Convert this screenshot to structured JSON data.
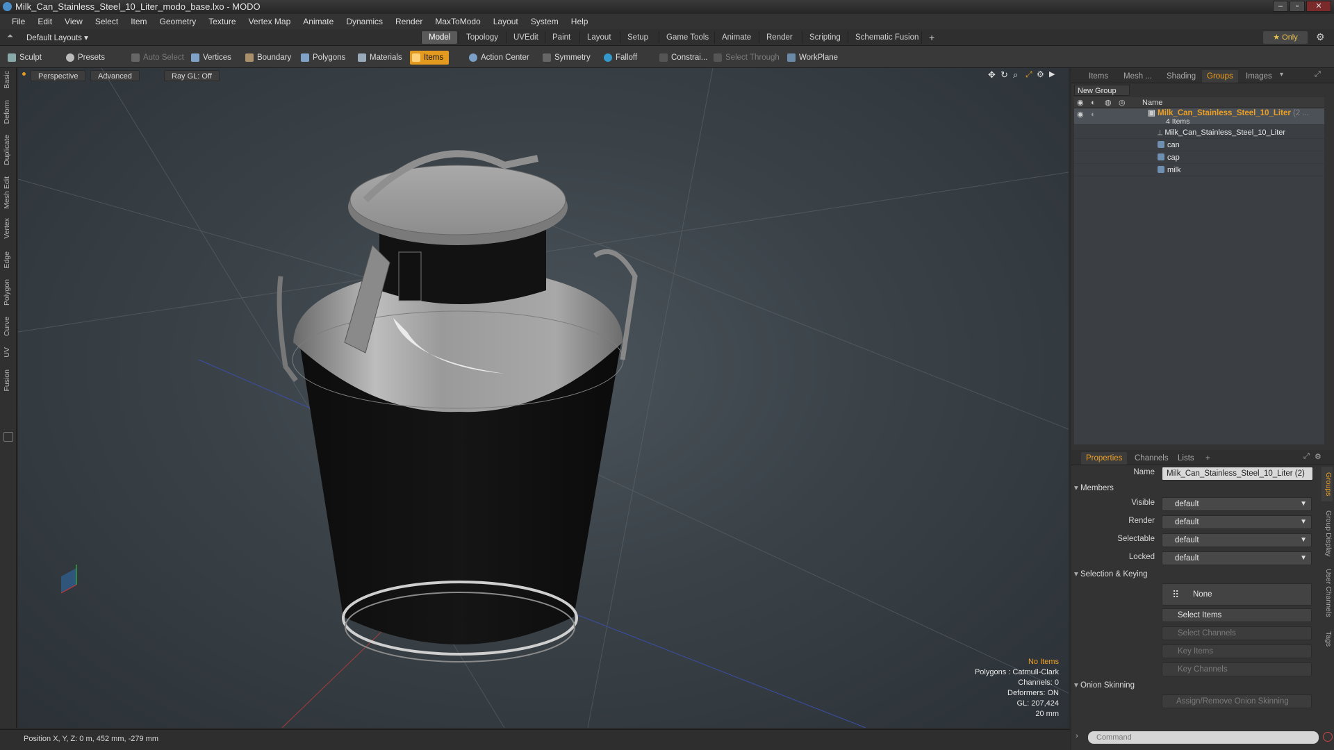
{
  "window": {
    "title": "Milk_Can_Stainless_Steel_10_Liter_modo_base.lxo - MODO",
    "controls": [
      "–",
      "▫",
      "✕"
    ]
  },
  "menu": [
    "File",
    "Edit",
    "View",
    "Select",
    "Item",
    "Geometry",
    "Texture",
    "Vertex Map",
    "Animate",
    "Dynamics",
    "Render",
    "MaxToModo",
    "Layout",
    "System",
    "Help"
  ],
  "layout": {
    "default_layouts": "Default Layouts ▾",
    "tabs": [
      "Model",
      "Topology",
      "UVEdit",
      "Paint",
      "Layout",
      "Setup",
      "Game Tools",
      "Animate",
      "Render",
      "Scripting",
      "Schematic Fusion"
    ],
    "active_tab": "Model",
    "add": "+",
    "only": "★ Only"
  },
  "toolbar": {
    "sculpt": "Sculpt",
    "presets": "Presets",
    "auto_select": "Auto Select",
    "vertices": "Vertices",
    "boundary": "Boundary",
    "polygons": "Polygons",
    "materials": "Materials",
    "items": "Items",
    "action_center": "Action Center",
    "symmetry": "Symmetry",
    "falloff": "Falloff",
    "constraints": "Constrai...",
    "select_through": "Select Through",
    "workplane": "WorkPlane"
  },
  "left_tabs": [
    "Basic",
    "Deform",
    "Duplicate",
    "Mesh Edit",
    "Vertex",
    "Edge",
    "Polygon",
    "Curve",
    "UV",
    "Fusion"
  ],
  "viewport": {
    "perspective": "Perspective",
    "advanced": "Advanced",
    "raygl": "Ray GL: Off",
    "stats": {
      "no_items": "No Items",
      "polygons": "Polygons : Catmull-Clark",
      "channels": "Channels: 0",
      "deformers": "Deformers: ON",
      "gl": "GL: 207,424",
      "scale": "20 mm"
    }
  },
  "status": {
    "position": "Position X, Y, Z:  0 m, 452 mm, -279 mm"
  },
  "outliner": {
    "tabs": [
      "Items",
      "Mesh ...",
      "Shading",
      "Groups",
      "Images"
    ],
    "active_tab": "Groups",
    "new_group": "New Group",
    "col_name": "Name",
    "group_name": "Milk_Can_Stainless_Steel_10_Liter",
    "group_suffix": "(2 ...",
    "group_count": "4 Items",
    "children": [
      "Milk_Can_Stainless_Steel_10_Liter",
      "can",
      "cap",
      "milk"
    ]
  },
  "properties": {
    "tabs": [
      "Properties",
      "Channels",
      "Lists",
      "+"
    ],
    "active_tab": "Properties",
    "name_label": "Name",
    "name_value": "Milk_Can_Stainless_Steel_10_Liter (2)",
    "members": "Members",
    "fields": [
      {
        "label": "Visible",
        "value": "default"
      },
      {
        "label": "Render",
        "value": "default"
      },
      {
        "label": "Selectable",
        "value": "default"
      },
      {
        "label": "Locked",
        "value": "default"
      }
    ],
    "selection_keying": "Selection & Keying",
    "none": "None",
    "select_items": "Select Items",
    "select_channels": "Select Channels",
    "key_items": "Key Items",
    "key_channels": "Key Channels",
    "onion": "Onion Skinning",
    "assign_onion": "Assign/Remove Onion Skinning",
    "side_tabs": [
      "Groups",
      "Group Display",
      "User Channels",
      "Tags"
    ],
    "command_placeholder": "Command"
  }
}
